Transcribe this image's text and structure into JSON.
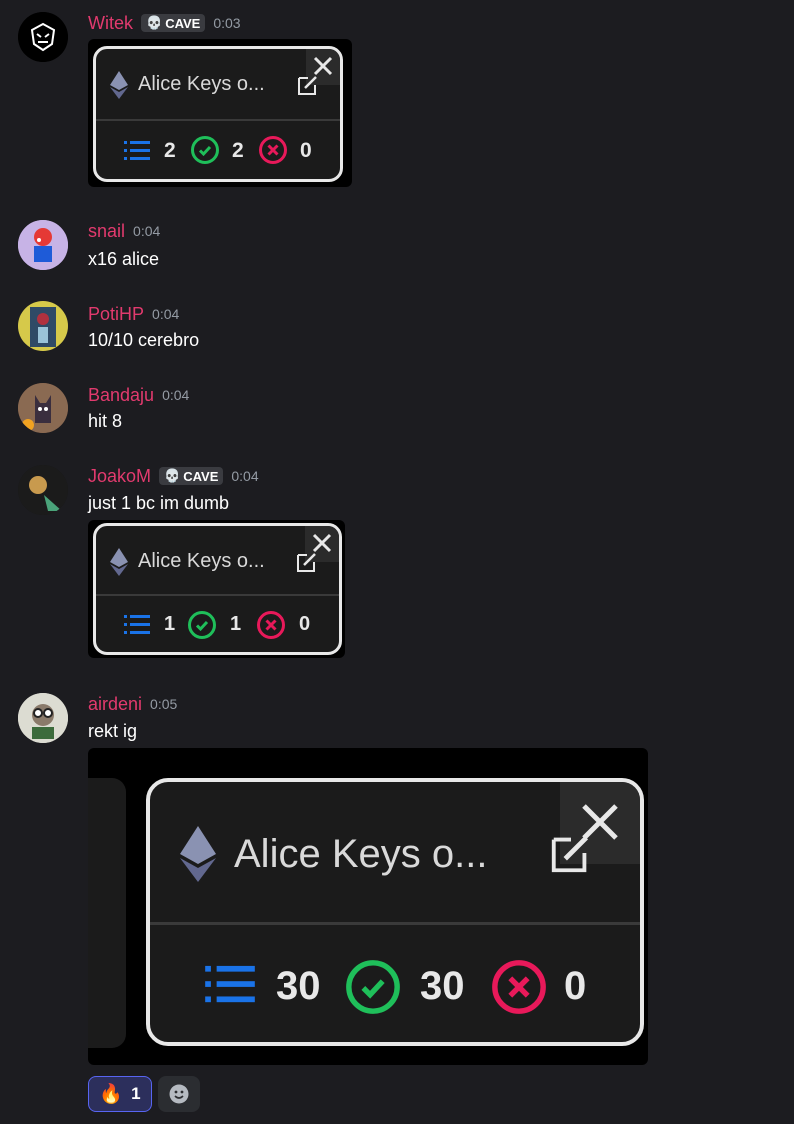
{
  "messages": [
    {
      "username": "Witek",
      "tag": "CAVE",
      "time": "0:03",
      "text": "",
      "embed": {
        "title": "Alice Keys o...",
        "total": "2",
        "correct": "2",
        "wrong": "0"
      }
    },
    {
      "username": "snail",
      "time": "0:04",
      "text": "x16 alice"
    },
    {
      "username": "PotiHP",
      "time": "0:04",
      "text": "10/10 cerebro"
    },
    {
      "username": "Bandaju",
      "time": "0:04",
      "text": "hit 8"
    },
    {
      "username": "JoakoM",
      "tag": "CAVE",
      "time": "0:04",
      "text": "just 1 bc im dumb",
      "embed": {
        "title": "Alice Keys o...",
        "total": "1",
        "correct": "1",
        "wrong": "0"
      }
    },
    {
      "username": "airdeni",
      "time": "0:05",
      "text": "rekt ig",
      "embed": {
        "title": "Alice Keys o...",
        "total": "30",
        "correct": "30",
        "wrong": "0"
      }
    }
  ],
  "reactions": [
    {
      "emoji": "🔥",
      "count": "1"
    }
  ],
  "icons": {
    "tag": "skull-icon",
    "list": "list-icon",
    "correct": "check-circle-icon",
    "wrong": "x-circle-icon",
    "edit": "edit-icon",
    "close": "close-icon",
    "eth": "ethereum-icon",
    "add_reaction": "add-reaction-icon"
  },
  "colors": {
    "username": "#e23a6e",
    "check": "#1fbf5a",
    "cross": "#e8195a",
    "list": "#1a73e8",
    "background": "#1c1c20"
  }
}
